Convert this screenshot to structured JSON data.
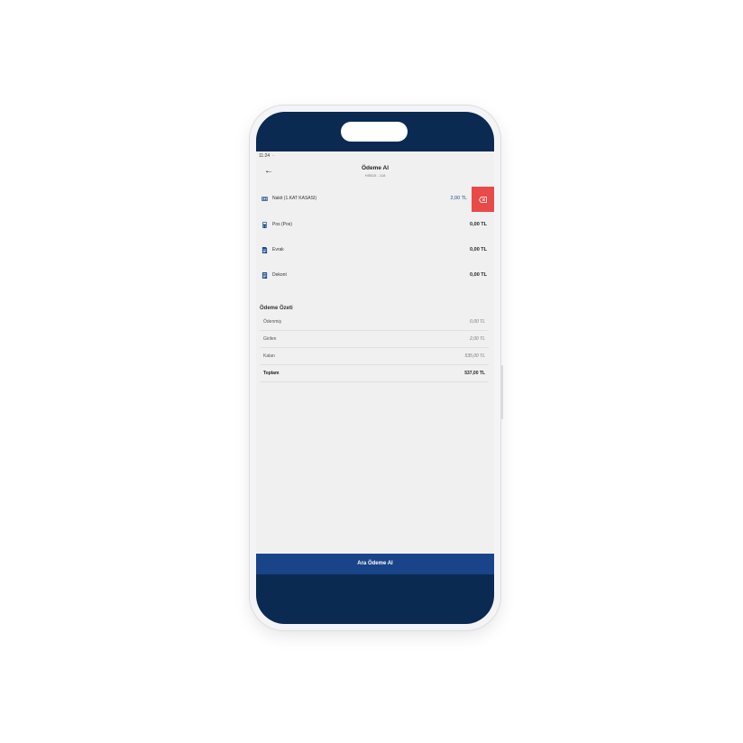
{
  "status": {
    "time": "11:24",
    "indicator": "·"
  },
  "header": {
    "back_icon": "←",
    "title": "Ödeme Al",
    "subtitle": "HSB15 - 118"
  },
  "payments": [
    {
      "label": "Nakit (1.KAT KASASI)",
      "amount": "2,00 TL",
      "icon": "cash-icon",
      "color": "#1e4a8a"
    },
    {
      "label": "Pos (Pos)",
      "amount": "0,00 TL",
      "icon": "pos-icon",
      "color": "#1e4a8a"
    },
    {
      "label": "Evrak",
      "amount": "0,00 TL",
      "icon": "document-icon",
      "color": "#1e4a8a"
    },
    {
      "label": "Dekont",
      "amount": "0,00 TL",
      "icon": "receipt-icon",
      "color": "#1e4a8a"
    }
  ],
  "delete_icon": "backspace-icon",
  "summary": {
    "title": "Ödeme Özeti",
    "rows": [
      {
        "label": "Ödenmiş",
        "value": "0,00 TL"
      },
      {
        "label": "Girilen",
        "value": "2,00 TL"
      },
      {
        "label": "Kalan",
        "value": "535,00 TL"
      },
      {
        "label": "Toplam",
        "value": "537,00 TL"
      }
    ]
  },
  "cta": {
    "label": "Ara Ödeme Al"
  },
  "colors": {
    "navy": "#0a2a52",
    "primary": "#1a4489",
    "danger": "#e84a4a"
  }
}
